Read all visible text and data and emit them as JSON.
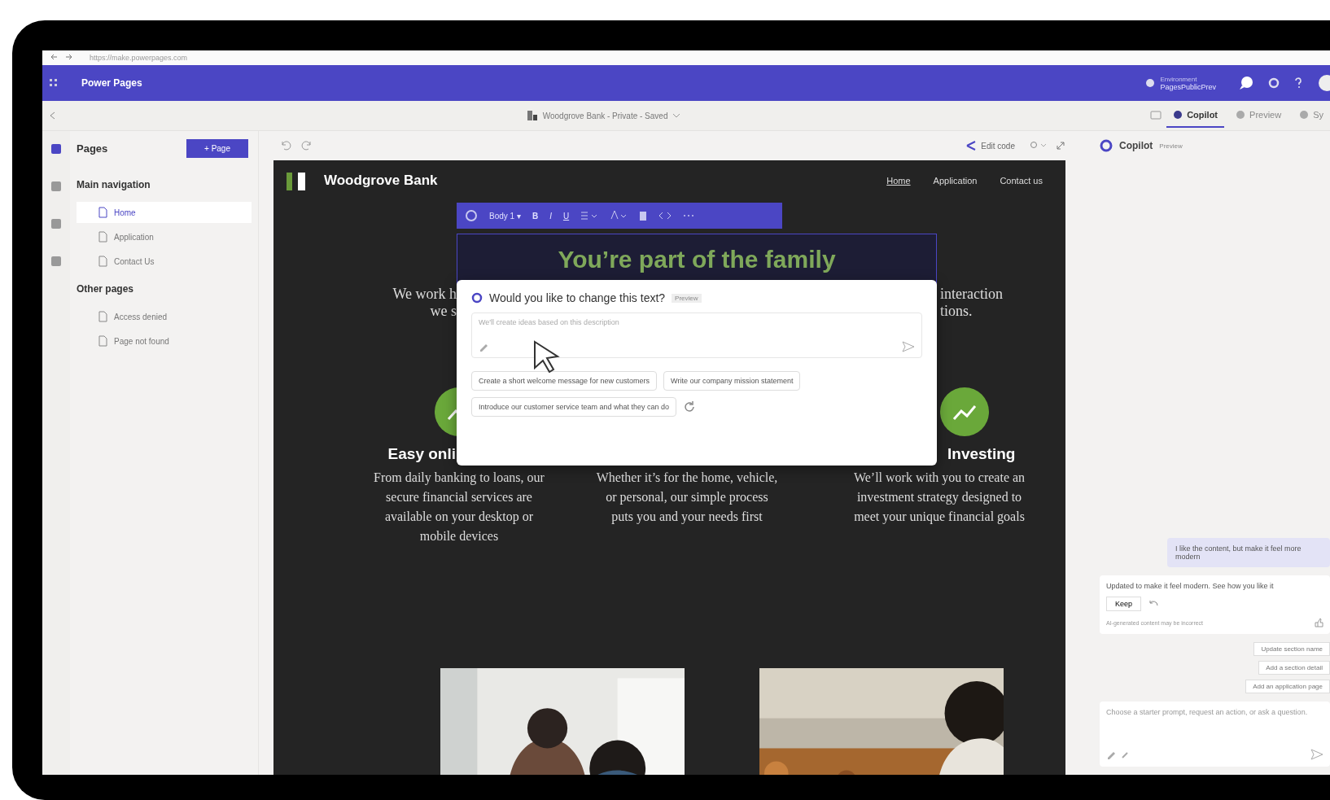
{
  "browser": {
    "url": "https://make.powerpages.com"
  },
  "app_bar": {
    "title": "Power Pages",
    "environment_label": "Environment",
    "environment": "PagesPublicPrev"
  },
  "command_bar": {
    "site": "Woodgrove Bank - Private - Saved",
    "tabs": [
      {
        "label": "Copilot",
        "selected": true
      },
      {
        "label": "Preview",
        "selected": false
      },
      {
        "label": "Sy",
        "selected": false
      }
    ]
  },
  "pages_panel": {
    "title": "Pages",
    "add_button": "+ Page",
    "sections": [
      {
        "title": "Main navigation",
        "items": [
          {
            "label": "Home",
            "selected": true
          },
          {
            "label": "Application",
            "selected": false
          },
          {
            "label": "Contact Us",
            "selected": false
          }
        ]
      },
      {
        "title": "Other pages",
        "items": [
          {
            "label": "Access denied",
            "selected": false
          },
          {
            "label": "Page not found",
            "selected": false
          }
        ]
      }
    ]
  },
  "canvas_toolbar": {
    "edit_code": "Edit code"
  },
  "site": {
    "brand": "Woodgrove Bank",
    "nav": [
      {
        "label": "Home",
        "selected": true
      },
      {
        "label": "Application",
        "selected": false
      },
      {
        "label": "Contact us",
        "selected": false
      }
    ],
    "heading": "You’re part of the family",
    "format_toolbar": {
      "style": "Body 1",
      "style_caret": "▾",
      "bold": "B",
      "italic": "I",
      "underline": "U"
    },
    "intro_left": [
      "We work h",
      "we s"
    ],
    "intro_right": [
      "interaction",
      "tions."
    ],
    "features": [
      {
        "title": "Easy onli",
        "text": "From daily banking to loans, our secure financial services are available on your desktop or mobile devices",
        "icon": true
      },
      {
        "text": "Whether it’s for the home, vehicle, or personal, our simple process puts you and your needs first",
        "icon": false
      },
      {
        "title": "Investing",
        "text": "We’ll work with you to create an investment strategy designed to meet your unique financial goals",
        "icon": true
      }
    ],
    "photos": [
      {
        "kind": "picture"
      },
      {
        "kind": "picture"
      }
    ]
  },
  "text_popup": {
    "title": "Would you like to change this text?",
    "badge": "Preview",
    "placeholder": "We'll create ideas based on this description",
    "suggestions": [
      "Create a short welcome message for new customers",
      "Write our company mission statement",
      "Introduce our customer service team and what they can do"
    ]
  },
  "copilot": {
    "title": "Copilot",
    "badge": "Preview",
    "user_message": "I like the content, but make it feel more modern",
    "reply": "Updated to make it feel modern. See how you like it",
    "keep_button": "Keep",
    "note": "AI-generated content may be incorrect",
    "suggestions": [
      "Update section name",
      "Add a section detail",
      "Add an application page"
    ],
    "input_placeholder": "Choose a starter prompt, request an action, or ask a question."
  }
}
